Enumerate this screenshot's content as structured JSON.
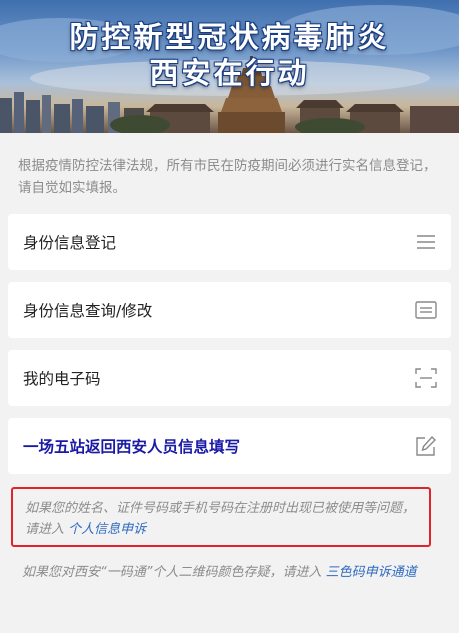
{
  "banner": {
    "title_line1": "防控新型冠状病毒肺炎",
    "title_line2": "西安在行动"
  },
  "intro_text": "根据疫情防控法律法规，所有市民在防疫期间必须进行实名信息登记，请自觉如实填报。",
  "menu": [
    {
      "label": "身份信息登记",
      "icon": "menu-lines-icon"
    },
    {
      "label": "身份信息查询/修改",
      "icon": "id-card-icon"
    },
    {
      "label": "我的电子码",
      "icon": "scan-frame-icon"
    },
    {
      "label": "一场五站返回西安人员信息填写",
      "icon": "edit-pen-icon"
    }
  ],
  "notice": {
    "text": "如果您的姓名、证件号码或手机号码在注册时出现已被使用等问题，请进入",
    "link": "个人信息申诉"
  },
  "footnote": {
    "text": "如果您对西安“一码通”个人二维码颜色存疑，请进入",
    "link": "三色码申诉通道"
  },
  "colors": {
    "highlight": "#1a1aa6",
    "link": "#2f6bc1",
    "notice_border": "#e0242b"
  }
}
